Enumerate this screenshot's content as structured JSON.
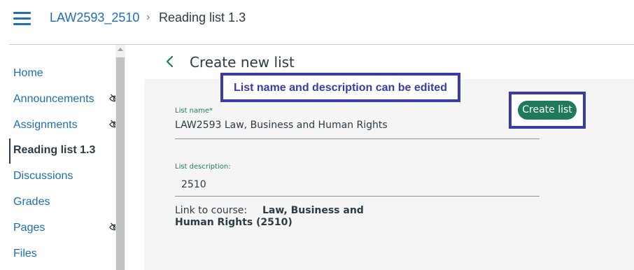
{
  "header": {
    "breadcrumb": {
      "course": "LAW2593_2510",
      "separator": "›",
      "current": "Reading list 1.3"
    }
  },
  "nav": {
    "items": [
      {
        "label": "Home",
        "hidden_icon": false,
        "active": false
      },
      {
        "label": "Announcements",
        "hidden_icon": true,
        "active": false
      },
      {
        "label": "Assignments",
        "hidden_icon": true,
        "active": false
      },
      {
        "label": "Reading list 1.3",
        "hidden_icon": false,
        "active": true
      },
      {
        "label": "Discussions",
        "hidden_icon": false,
        "active": false
      },
      {
        "label": "Grades",
        "hidden_icon": false,
        "active": false
      },
      {
        "label": "Pages",
        "hidden_icon": true,
        "active": false
      },
      {
        "label": "Files",
        "hidden_icon": false,
        "active": false
      }
    ]
  },
  "panel": {
    "title": "Create new list",
    "create_button": "Create list",
    "list_name": {
      "label": "List name*",
      "value": "LAW2593 Law, Business and Human Rights"
    },
    "list_description": {
      "label": "List description:",
      "value": "2510"
    },
    "link_to_course": {
      "label": "Link to course:",
      "value_line1": "Law, Business and",
      "value_line2": "Human Rights (2510)"
    }
  },
  "annotation": {
    "callout_text": "List name and description can be edited",
    "color": "#3b3ba8"
  },
  "colors": {
    "link": "#1e6eb5",
    "primary_button": "#1f7a5a",
    "text": "#2d3b45"
  },
  "icons": {
    "menu": "hamburger-icon",
    "hidden": "eye-slash-icon",
    "back": "chevron-left-icon"
  }
}
